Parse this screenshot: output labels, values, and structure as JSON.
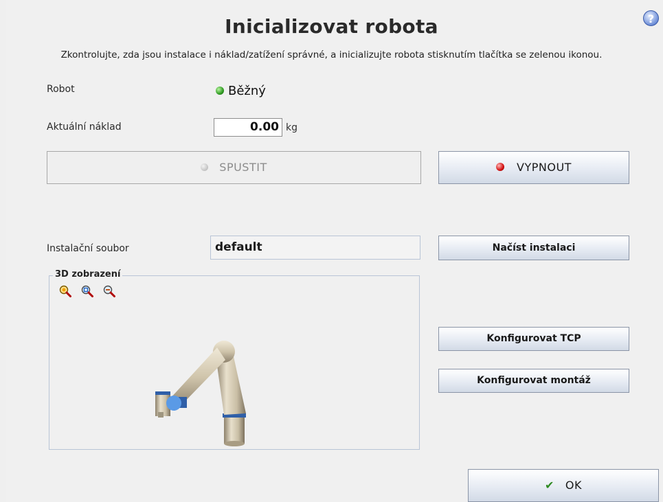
{
  "dialog": {
    "title": "Inicializovat robota",
    "subtitle": "Zkontrolujte, zda jsou instalace i náklad/zatížení správné, a inicializujte robota stisknutím tlačítka se zelenou ikonou.",
    "help_label": "?"
  },
  "robot": {
    "label": "Robot",
    "status": "Běžný",
    "status_color": "#2f9a22"
  },
  "payload": {
    "label": "Aktuální náklad",
    "value": "0.00",
    "unit": "kg"
  },
  "buttons": {
    "start": "SPUSTIT",
    "off": "VYPNOUT",
    "load_installation": "Načíst instalaci",
    "configure_tcp": "Konfigurovat TCP",
    "configure_mount": "Konfigurovat montáž",
    "ok": "OK"
  },
  "installation": {
    "label": "Instalační soubor",
    "value": "default"
  },
  "view3d": {
    "title": "3D zobrazení",
    "icons": [
      "zoom-fit-icon",
      "zoom-in-icon",
      "zoom-out-icon"
    ]
  },
  "colors": {
    "accent_blue": "#3d5fb2",
    "led_red": "#d21010",
    "led_gray": "#c9c9c9",
    "check_green": "#2f8a22"
  }
}
